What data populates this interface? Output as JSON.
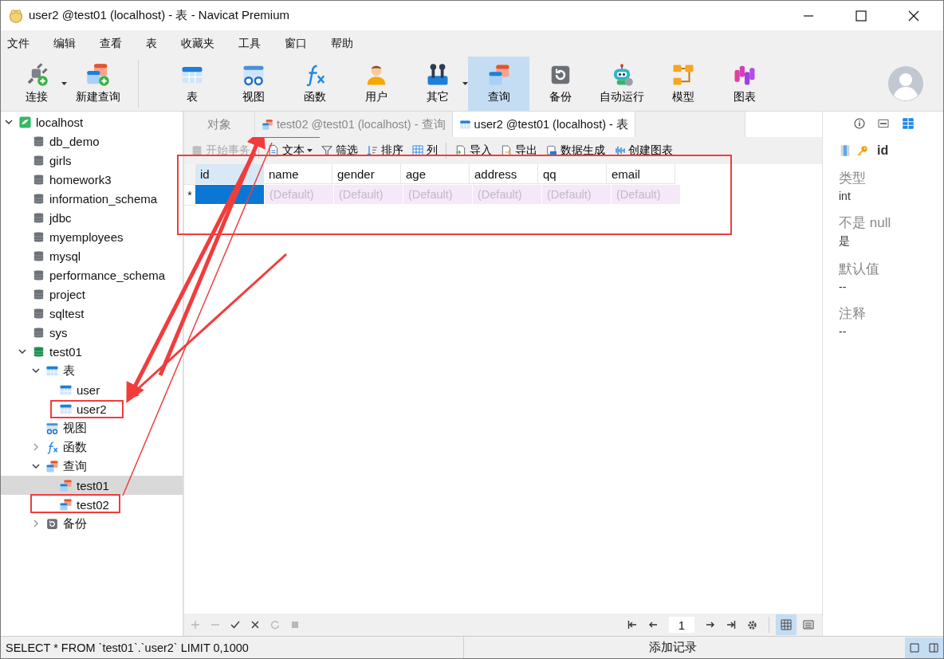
{
  "window": {
    "title": "user2 @test01 (localhost) - 表 - Navicat Premium"
  },
  "menu": [
    "文件",
    "编辑",
    "查看",
    "表",
    "收藏夹",
    "工具",
    "窗口",
    "帮助"
  ],
  "toolbar": [
    {
      "label": "连接",
      "kind": "connect",
      "selected": false,
      "dropdown": true
    },
    {
      "label": "新建查询",
      "kind": "newquery",
      "selected": false,
      "dropdown": false
    },
    {
      "label": "表",
      "kind": "table",
      "selected": false,
      "dropdown": false
    },
    {
      "label": "视图",
      "kind": "view",
      "selected": false,
      "dropdown": false
    },
    {
      "label": "函数",
      "kind": "func",
      "selected": false,
      "dropdown": false
    },
    {
      "label": "用户",
      "kind": "user",
      "selected": false,
      "dropdown": false
    },
    {
      "label": "其它",
      "kind": "tools",
      "selected": false,
      "dropdown": true
    },
    {
      "label": "查询",
      "kind": "query",
      "selected": true,
      "dropdown": false
    },
    {
      "label": "备份",
      "kind": "backup",
      "selected": false,
      "dropdown": false
    },
    {
      "label": "自动运行",
      "kind": "robot",
      "selected": false,
      "dropdown": false
    },
    {
      "label": "模型",
      "kind": "model",
      "selected": false,
      "dropdown": false
    },
    {
      "label": "图表",
      "kind": "chart",
      "selected": false,
      "dropdown": false
    }
  ],
  "tree": [
    {
      "label": "localhost",
      "kind": "server",
      "expanded": true,
      "selected": false,
      "children": [
        {
          "label": "db_demo",
          "kind": "db",
          "selected": false
        },
        {
          "label": "girls",
          "kind": "db",
          "selected": false
        },
        {
          "label": "homework3",
          "kind": "db",
          "selected": false
        },
        {
          "label": "information_schema",
          "kind": "db",
          "selected": false
        },
        {
          "label": "jdbc",
          "kind": "db",
          "selected": false
        },
        {
          "label": "myemployees",
          "kind": "db",
          "selected": false
        },
        {
          "label": "mysql",
          "kind": "db",
          "selected": false
        },
        {
          "label": "performance_schema",
          "kind": "db",
          "selected": false
        },
        {
          "label": "project",
          "kind": "db",
          "selected": false
        },
        {
          "label": "sqltest",
          "kind": "db",
          "selected": false
        },
        {
          "label": "sys",
          "kind": "db",
          "selected": false
        },
        {
          "label": "test01",
          "kind": "db-open",
          "expanded": true,
          "selected": false,
          "children": [
            {
              "label": "表",
              "kind": "table",
              "expanded": true,
              "selected": false,
              "children": [
                {
                  "label": "user",
                  "kind": "table",
                  "selected": false
                },
                {
                  "label": "user2",
                  "kind": "table",
                  "selected": false
                }
              ]
            },
            {
              "label": "视图",
              "kind": "view",
              "selected": false
            },
            {
              "label": "函数",
              "kind": "func",
              "expanded": false,
              "selected": false
            },
            {
              "label": "查询",
              "kind": "query",
              "expanded": true,
              "selected": false,
              "children": [
                {
                  "label": "test01",
                  "kind": "query",
                  "selected": true
                },
                {
                  "label": "test02",
                  "kind": "query",
                  "selected": false
                }
              ]
            },
            {
              "label": "备份",
              "kind": "backup",
              "expanded": false,
              "selected": false
            }
          ]
        }
      ]
    }
  ],
  "tabs": [
    {
      "label": "对象",
      "kind": "objects",
      "selected": false
    },
    {
      "label": "test02 @test01 (localhost) - 查询",
      "kind": "query",
      "selected": false
    },
    {
      "label": "user2 @test01 (localhost) - 表",
      "kind": "table",
      "selected": true
    }
  ],
  "actions": [
    {
      "label": "开始事务",
      "kind": "db",
      "disabled": true,
      "dropdown": false
    },
    {
      "label": "文本",
      "kind": "doc",
      "disabled": false,
      "dropdown": true
    },
    {
      "label": "筛选",
      "kind": "filter",
      "disabled": false,
      "dropdown": false
    },
    {
      "label": "排序",
      "kind": "sort",
      "disabled": false,
      "dropdown": false
    },
    {
      "label": "列",
      "kind": "grid",
      "disabled": false,
      "dropdown": false
    },
    {
      "label": "导入",
      "kind": "import",
      "disabled": false,
      "dropdown": false
    },
    {
      "label": "导出",
      "kind": "export",
      "disabled": false,
      "dropdown": false
    },
    {
      "label": "数据生成",
      "kind": "datagen",
      "disabled": false,
      "dropdown": false
    },
    {
      "label": "创建图表",
      "kind": "wave",
      "disabled": false,
      "dropdown": false
    }
  ],
  "table": {
    "columns": [
      {
        "label": "id",
        "selected": true
      },
      {
        "label": "name",
        "selected": false
      },
      {
        "label": "gender",
        "selected": false
      },
      {
        "label": "age",
        "selected": false
      },
      {
        "label": "address",
        "selected": false
      },
      {
        "label": "qq",
        "selected": false
      },
      {
        "label": "email",
        "selected": false
      }
    ],
    "rows": [
      {
        "marker": "*",
        "cells": [
          {
            "selected": true
          },
          {
            "placeholder": "(Default)",
            "selected": false
          },
          {
            "placeholder": "(Default)",
            "selected": false
          },
          {
            "placeholder": "(Default)",
            "selected": false
          },
          {
            "placeholder": "(Default)",
            "selected": false
          },
          {
            "placeholder": "(Default)",
            "selected": false
          },
          {
            "placeholder": "(Default)",
            "selected": false
          }
        ]
      }
    ]
  },
  "pager": {
    "page": "1"
  },
  "inspector": {
    "field": "id",
    "properties": [
      {
        "label": "类型",
        "value": "int"
      },
      {
        "label": "不是 null",
        "value": "是"
      },
      {
        "label": "默认值",
        "value": "--"
      },
      {
        "label": "注释",
        "value": "--"
      }
    ]
  },
  "status_bar": {
    "sql": "SELECT * FROM `test01`.`user2` LIMIT 0,1000",
    "message": "添加记录"
  }
}
